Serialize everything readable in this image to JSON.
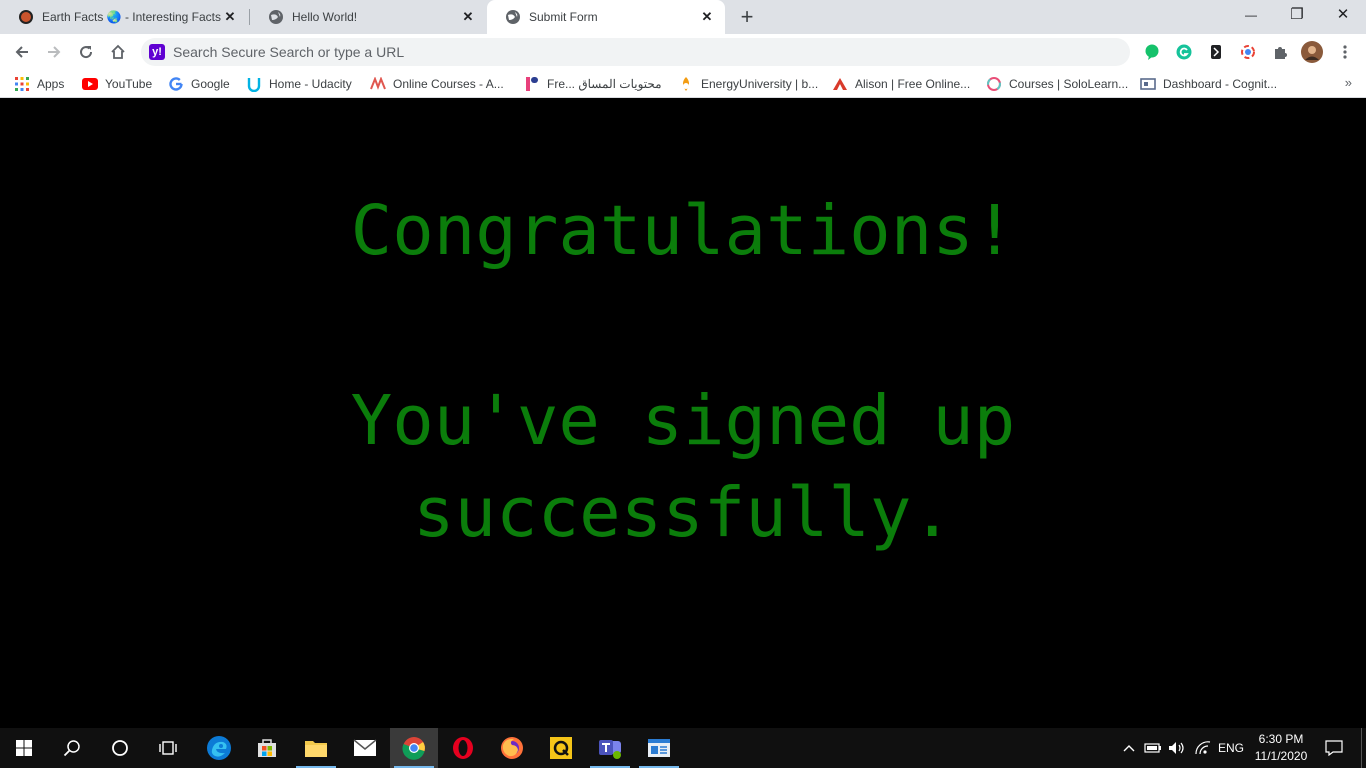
{
  "browser": {
    "tabs": [
      {
        "title": "Earth Facts 🌏 - Interesting Facts",
        "active": false
      },
      {
        "title": "Hello World!",
        "active": false
      },
      {
        "title": "Submit Form",
        "active": true
      }
    ],
    "new_tab_label": "+",
    "window_controls": {
      "minimize": "—",
      "maximize": "❐",
      "close": "✕"
    },
    "address_bar": {
      "value": "",
      "placeholder": "Search Secure Search or type a URL"
    },
    "bookmarks": [
      {
        "label": "Apps",
        "icon": "apps-grid-icon"
      },
      {
        "label": "YouTube",
        "icon": "youtube-icon"
      },
      {
        "label": "Google",
        "icon": "google-icon"
      },
      {
        "label": "Home - Udacity",
        "icon": "udacity-icon"
      },
      {
        "label": "Online Courses - A...",
        "icon": "online-courses-icon"
      },
      {
        "label": "Fre... محتويات المساق",
        "icon": "edraak-icon"
      },
      {
        "label": "EnergyUniversity | b...",
        "icon": "energy-university-icon"
      },
      {
        "label": "Alison | Free Online...",
        "icon": "alison-icon"
      },
      {
        "label": "Courses | SoloLearn...",
        "icon": "sololearn-icon"
      },
      {
        "label": "Dashboard - Cognit...",
        "icon": "cognitive-class-icon"
      }
    ],
    "bookmarks_overflow": "»"
  },
  "page": {
    "heading": "Congratulations!",
    "message_line1": "You've signed up",
    "message_line2": "successfully."
  },
  "taskbar": {
    "language": "ENG",
    "time": "6:30 PM",
    "date": "11/1/2020"
  },
  "colors": {
    "page_background": "#000000",
    "message_text": "#0b7d0b",
    "tabstrip": "#dee1e6",
    "taskbar": "#101010"
  }
}
